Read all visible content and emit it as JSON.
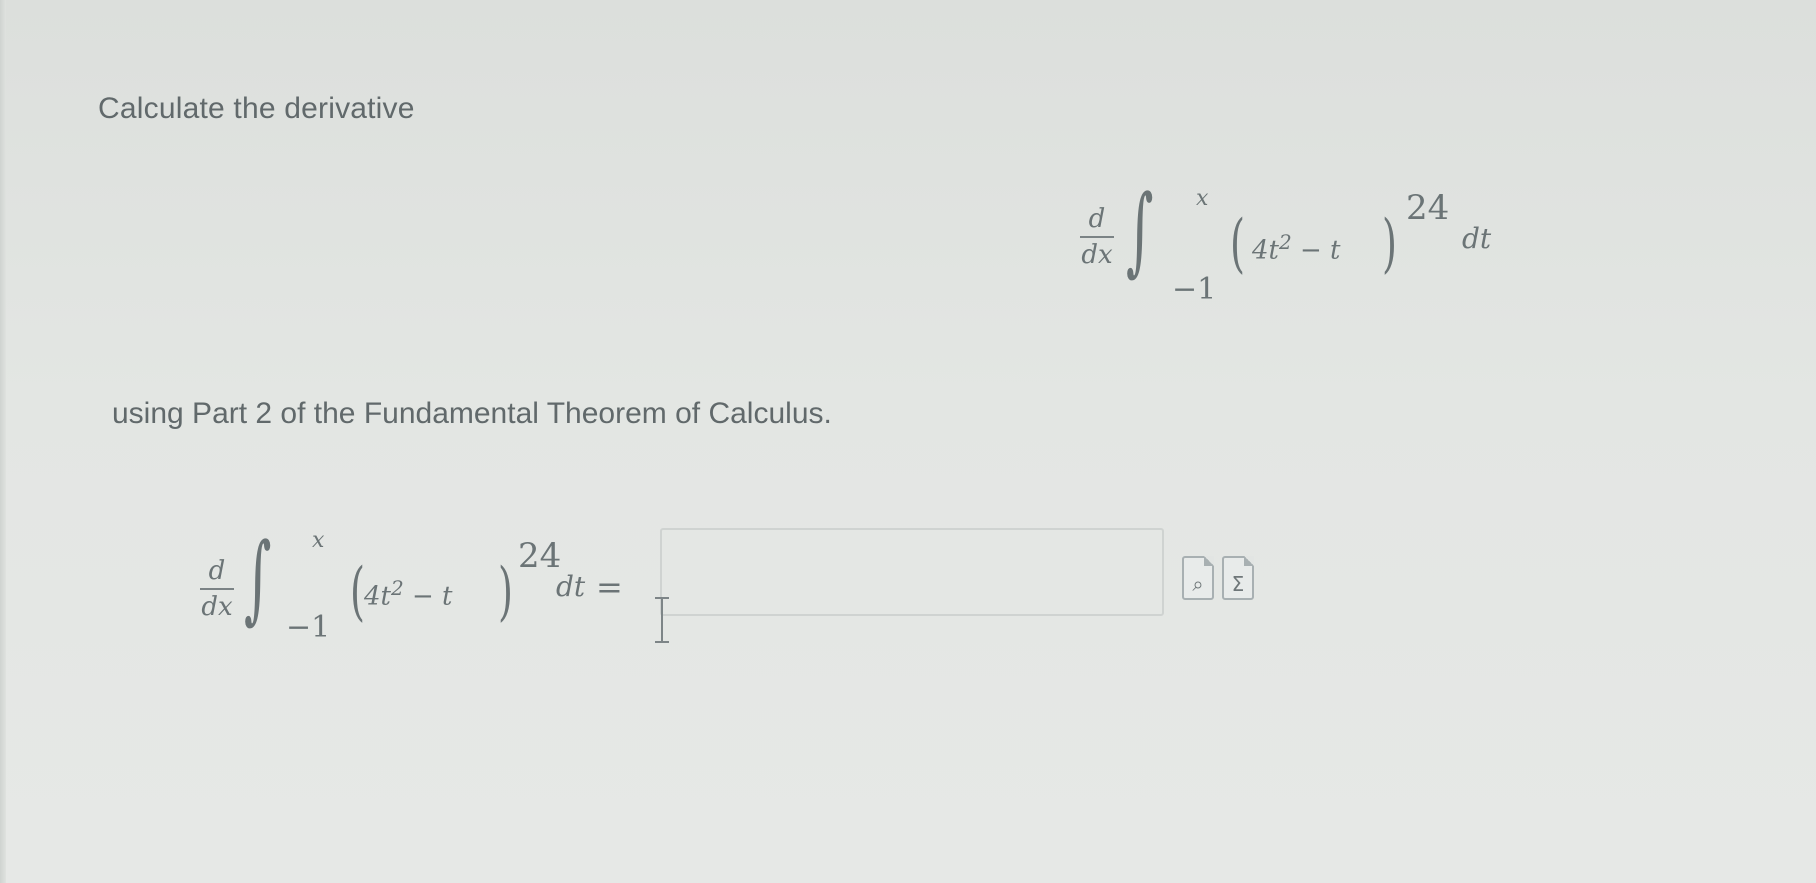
{
  "question": {
    "intro": "Calculate the derivative",
    "instruction": "using Part 2 of the Fundamental Theorem of Calculus."
  },
  "expression": {
    "d": "d",
    "dx": "dx",
    "integral_sign": "∫",
    "upper_limit": "x",
    "lower_limit": "−1",
    "left_paren": "(",
    "right_paren": ")",
    "integrand_coeff": "4t",
    "integrand_power": "2",
    "integrand_rest": " − t",
    "outer_exponent": "24",
    "differential": "dt",
    "equals": "="
  },
  "answer": {
    "value": ""
  },
  "toolbar": {
    "preview_icon": "magnifier-document-icon",
    "preview_glyph": "⌕",
    "symbols_icon": "sigma-document-icon",
    "symbols_glyph": "Σ"
  }
}
